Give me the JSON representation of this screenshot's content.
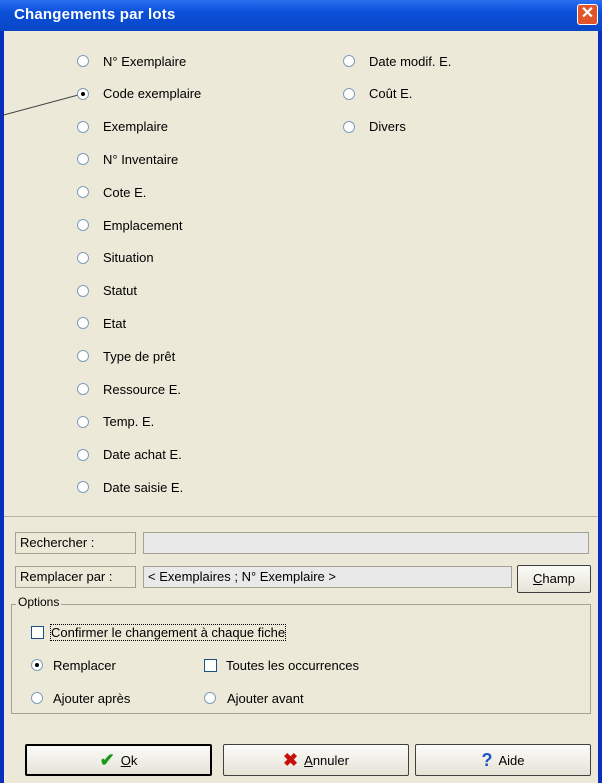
{
  "window": {
    "title": "Changements par lots",
    "close_icon": "close-icon",
    "close_color": "#e2552a"
  },
  "fields_left": [
    {
      "label": "N° Exemplaire",
      "selected": false
    },
    {
      "label": "Code exemplaire",
      "selected": true
    },
    {
      "label": "Exemplaire",
      "selected": false
    },
    {
      "label": "N° Inventaire",
      "selected": false
    },
    {
      "label": "Cote E.",
      "selected": false
    },
    {
      "label": "Emplacement",
      "selected": false
    },
    {
      "label": "Situation",
      "selected": false
    },
    {
      "label": "Statut",
      "selected": false
    },
    {
      "label": "Etat",
      "selected": false
    },
    {
      "label": "Type de prêt",
      "selected": false
    },
    {
      "label": "Ressource E.",
      "selected": false
    },
    {
      "label": "Temp. E.",
      "selected": false
    },
    {
      "label": "Date achat E.",
      "selected": false
    },
    {
      "label": "Date saisie E.",
      "selected": false
    }
  ],
  "fields_right": [
    {
      "label": "Date modif. E.",
      "selected": false
    },
    {
      "label": "Coût E.",
      "selected": false
    },
    {
      "label": "Divers",
      "selected": false
    }
  ],
  "search": {
    "label": "Rechercher :",
    "value": ""
  },
  "replace": {
    "label": "Remplacer par :",
    "value": "< Exemplaires ; N° Exemplaire >"
  },
  "champ_button": {
    "accel": "C",
    "rest": "hamp"
  },
  "options": {
    "legend": "Options",
    "confirm_label": "Confirmer le changement à chaque fiche",
    "confirm_checked": false,
    "replace_label": "Remplacer",
    "all_occurrences_label": "Toutes les occurrences",
    "all_occurrences_checked": false,
    "append_after_label": "Ajouter après",
    "append_before_label": "Ajouter avant",
    "selected_mode": "Remplacer"
  },
  "buttons": {
    "ok": {
      "accel": "O",
      "rest": "k",
      "icon": "checkmark-icon",
      "icon_color": "#1a9a1a"
    },
    "cancel": {
      "accel": "A",
      "rest": "nnuler",
      "icon": "cross-icon",
      "icon_color": "#c8100a"
    },
    "help": {
      "label": "Aide",
      "icon": "question-icon",
      "icon_color": "#1f53c8"
    }
  }
}
